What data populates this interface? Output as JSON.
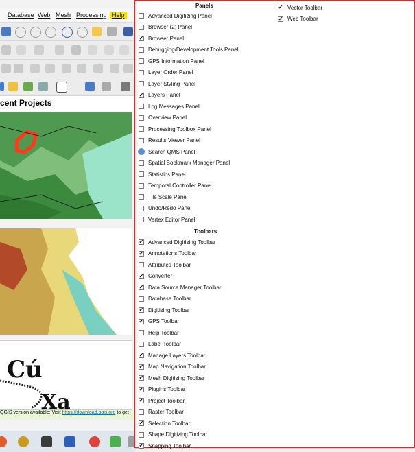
{
  "menu": [
    "Database",
    "Web",
    "Mesh",
    "Processing",
    "Help"
  ],
  "recent_title": "cent Projects",
  "thumb_text": [
    "Cú",
    "Xa"
  ],
  "status": {
    "text": "QGIS version available: Visit ",
    "link": "https://download.qgis.org",
    "after": " to get"
  },
  "panels_header": "Panels",
  "toolbars_header": "Toolbars",
  "panels": [
    {
      "label": "Advanced Digitizing Panel",
      "checked": false
    },
    {
      "label": "Browser (2) Panel",
      "checked": false
    },
    {
      "label": "Browser Panel",
      "checked": true
    },
    {
      "label": "Debugging/Development Tools Panel",
      "checked": false
    },
    {
      "label": "GPS Information Panel",
      "checked": false
    },
    {
      "label": "Layer Order Panel",
      "checked": false
    },
    {
      "label": "Layer Styling Panel",
      "checked": false
    },
    {
      "label": "Layers Panel",
      "checked": true
    },
    {
      "label": "Log Messages Panel",
      "checked": false
    },
    {
      "label": "Overview Panel",
      "checked": false
    },
    {
      "label": "Processing Toolbox Panel",
      "checked": false
    },
    {
      "label": "Results Viewer Panel",
      "checked": false
    },
    {
      "label": "Search QMS Panel",
      "checked": false,
      "icon": "qms-icon"
    },
    {
      "label": "Spatial Bookmark Manager Panel",
      "checked": false
    },
    {
      "label": "Statistics Panel",
      "checked": false
    },
    {
      "label": "Temporal Controller Panel",
      "checked": false
    },
    {
      "label": "Tile Scale Panel",
      "checked": false
    },
    {
      "label": "Undo/Redo Panel",
      "checked": false
    },
    {
      "label": "Vertex Editor Panel",
      "checked": false
    }
  ],
  "toolbars": [
    {
      "label": "Advanced Digitizing Toolbar",
      "checked": true
    },
    {
      "label": "Annotations Toolbar",
      "checked": true
    },
    {
      "label": "Attributes Toolbar",
      "checked": false
    },
    {
      "label": "Converter",
      "checked": true
    },
    {
      "label": "Data Source Manager Toolbar",
      "checked": true
    },
    {
      "label": "Database Toolbar",
      "checked": false
    },
    {
      "label": "Digitizing Toolbar",
      "checked": true
    },
    {
      "label": "GPS Toolbar",
      "checked": true
    },
    {
      "label": "Help Toolbar",
      "checked": false
    },
    {
      "label": "Label Toolbar",
      "checked": false
    },
    {
      "label": "Manage Layers Toolbar",
      "checked": true
    },
    {
      "label": "Map Navigation Toolbar",
      "checked": true
    },
    {
      "label": "Mesh Digitizing Toolbar",
      "checked": true
    },
    {
      "label": "Plugins Toolbar",
      "checked": true
    },
    {
      "label": "Project Toolbar",
      "checked": true
    },
    {
      "label": "Raster Toolbar",
      "checked": false
    },
    {
      "label": "Selection Toolbar",
      "checked": true
    },
    {
      "label": "Shape Digitizing Toolbar",
      "checked": false
    },
    {
      "label": "Snapping Toolbar",
      "checked": true
    }
  ],
  "toolbars_col2": [
    {
      "label": "Vector Toolbar",
      "checked": true
    },
    {
      "label": "Web Toolbar",
      "checked": true
    }
  ],
  "colors": {
    "highlight": "#f5e600",
    "panel_border": "#d32f2f"
  }
}
